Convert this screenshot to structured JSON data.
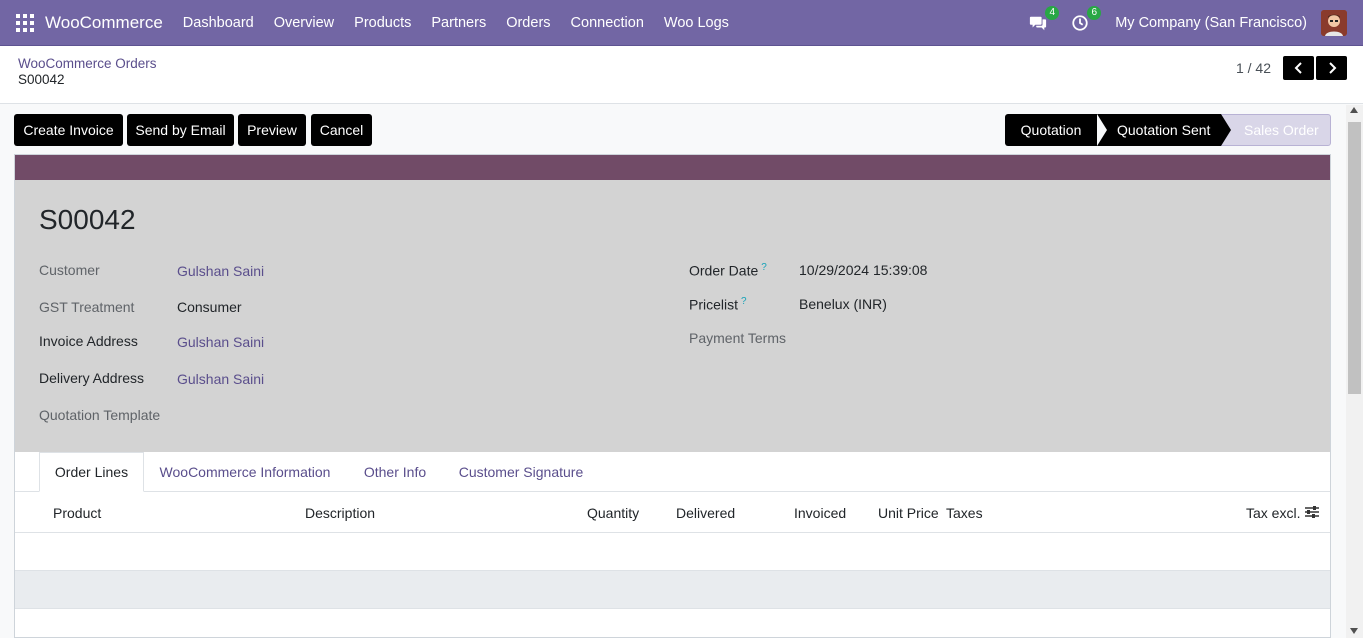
{
  "topbar": {
    "brand": "WooCommerce",
    "menu": [
      "Dashboard",
      "Overview",
      "Products",
      "Partners",
      "Orders",
      "Connection",
      "Woo Logs"
    ],
    "messages_count": "4",
    "activities_count": "6",
    "company": "My Company (San Francisco)",
    "color": "#7266a4"
  },
  "breadcrumb": {
    "parent": "WooCommerce Orders",
    "current": "S00042"
  },
  "pager": {
    "value": "1 / 42"
  },
  "actions": {
    "create_invoice": "Create Invoice",
    "send_by_email": "Send by Email",
    "preview": "Preview",
    "cancel": "Cancel"
  },
  "statusbar": {
    "stages": [
      "Quotation",
      "Quotation Sent",
      "Sales Order"
    ],
    "current": "Quotation Sent"
  },
  "form": {
    "title": "S00042",
    "ribbon_color": "#714b67",
    "left": {
      "customer_label": "Customer",
      "customer_value": "Gulshan Saini",
      "gst_label": "GST Treatment",
      "gst_value": "Consumer",
      "invoice_label": "Invoice Address",
      "invoice_value": "Gulshan Saini",
      "delivery_label": "Delivery Address",
      "delivery_value": "Gulshan Saini",
      "template_label": "Quotation Template"
    },
    "right": {
      "order_date_label": "Order Date",
      "order_date_value": "10/29/2024 15:39:08",
      "pricelist_label": "Pricelist",
      "pricelist_value": "Benelux (INR)",
      "payment_terms_label": "Payment Terms",
      "help_mark": "?"
    }
  },
  "tabs": [
    "Order Lines",
    "WooCommerce Information",
    "Other Info",
    "Customer Signature"
  ],
  "order_lines": {
    "columns": [
      "Product",
      "Description",
      "Quantity",
      "Delivered",
      "Invoiced",
      "Unit Price",
      "Taxes",
      "Tax excl."
    ]
  }
}
